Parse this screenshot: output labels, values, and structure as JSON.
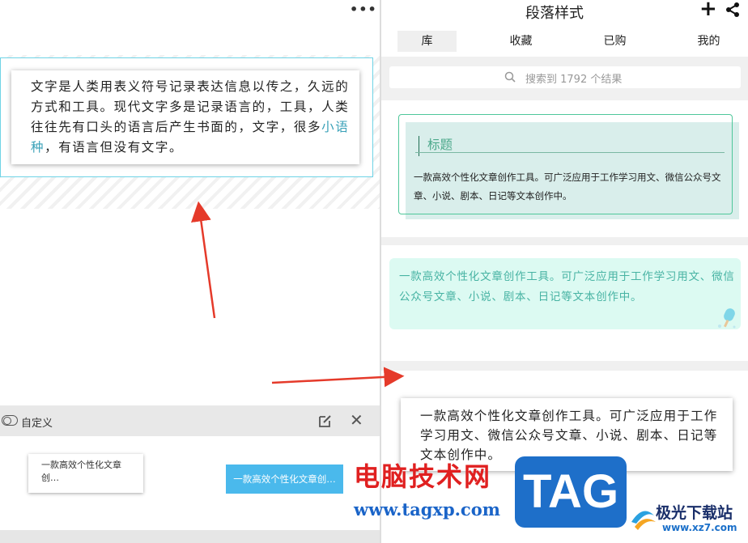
{
  "editor": {
    "more_label": "•••",
    "paragraph_before": "文字是人类用表义符号记录表达信息以传之，久远的方式和工具。现代文字多是记录语言的，工具，人类往往先有口头的语言后产生书面的，文字，很多",
    "paragraph_link": "小语种",
    "paragraph_after": "，有语言但没有文字。",
    "custom_label": "自定义",
    "custom_card_text": "一款高效个性化文章创…",
    "custom_button_text": "一款高效个性化文章创…"
  },
  "panel": {
    "title": "段落样式",
    "tabs": [
      "库",
      "收藏",
      "已购",
      "我的"
    ],
    "active_tab": 0,
    "search_placeholder": "搜索到 1792 个结果",
    "template1": {
      "title": "标题",
      "body": "一款高效个性化文章创作工具。可广泛应用于工作学习用文、微信公众号文章、小说、剧本、日记等文本创作中。"
    },
    "template2": {
      "body": "一款高效个性化文章创作工具。可广泛应用于工作学习用文、微信公众号文章、小说、剧本、日记等文本创作中。"
    },
    "template3": {
      "body": "一款高效个性化文章创作工具。可广泛应用于工作学习用文、微信公众号文章、小说、剧本、日记等文本创作中。"
    }
  },
  "watermark": {
    "site_cn": "电脑技术网",
    "site_url": "www.tagxp.com",
    "tag": "TAG",
    "logo_cn": "极光下载站",
    "logo_url": "www.xz7.com"
  },
  "colors": {
    "accent_cyan": "#6fd3e6",
    "arrow_red": "#e53a2a",
    "template_green": "#4fc79a",
    "button_blue": "#4ab9ec"
  }
}
